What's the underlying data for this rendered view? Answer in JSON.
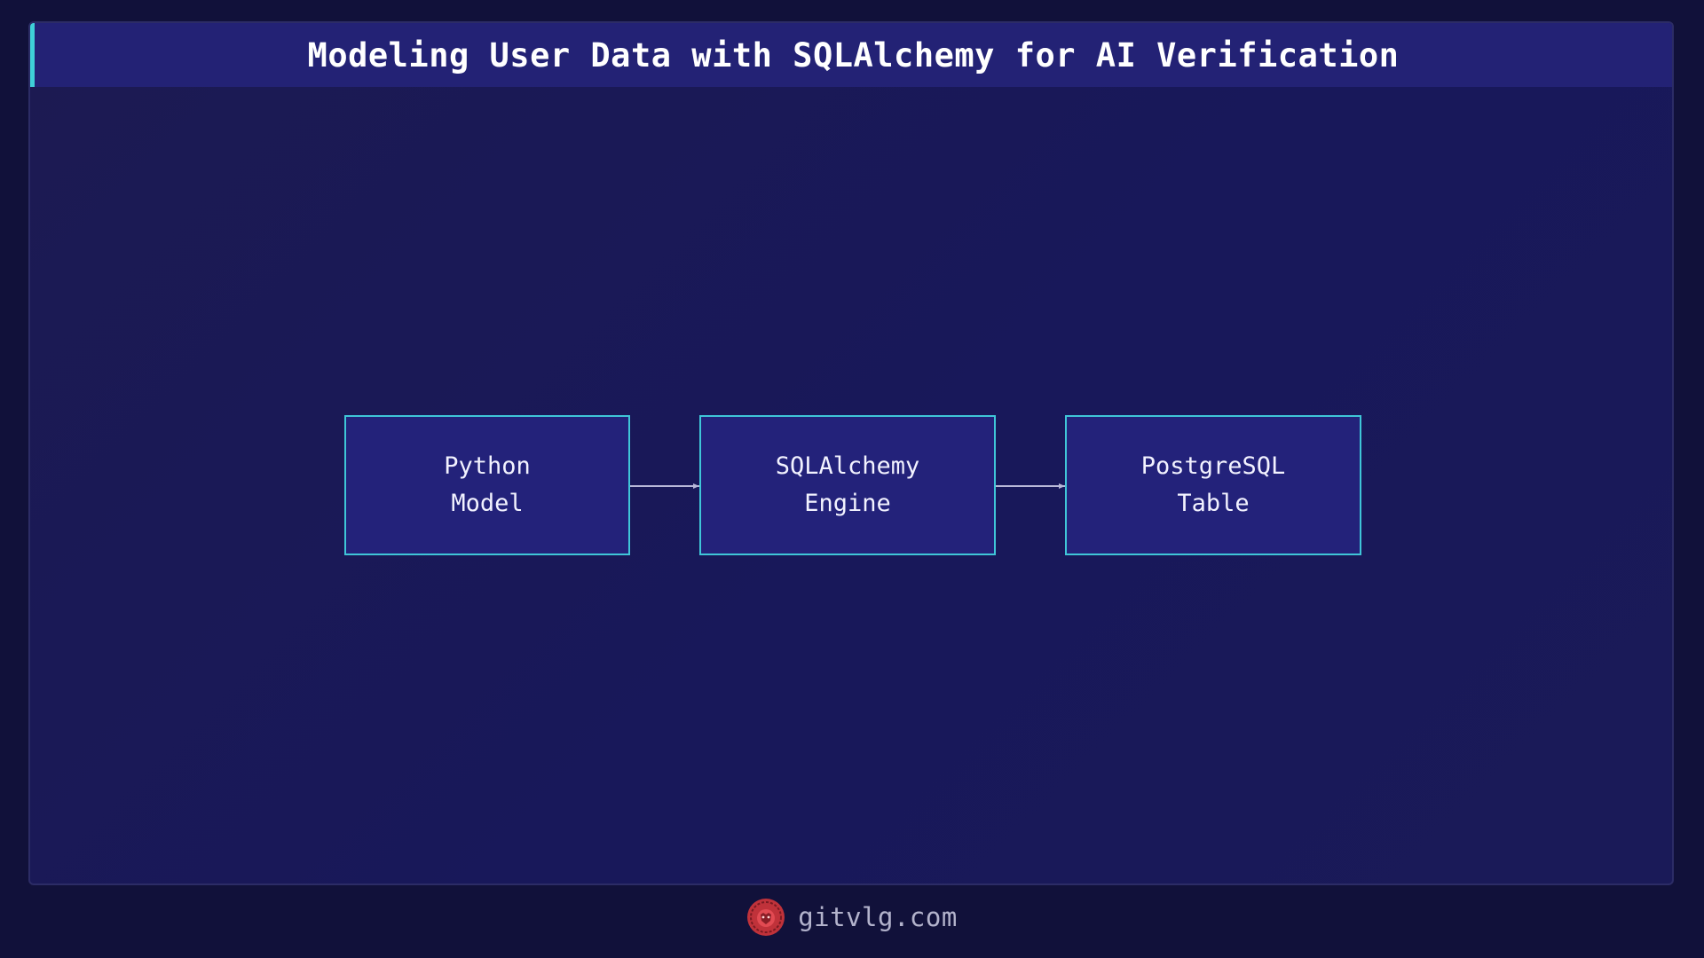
{
  "title": "Modeling User Data with SQLAlchemy for AI Verification",
  "diagram": {
    "nodes": [
      {
        "id": "python-model",
        "label": "Python\nModel"
      },
      {
        "id": "sqlalchemy-engine",
        "label": "SQLAlchemy\nEngine"
      },
      {
        "id": "postgresql-table",
        "label": "PostgreSQL\nTable"
      }
    ],
    "edges": [
      {
        "from": "python-model",
        "to": "sqlalchemy-engine"
      },
      {
        "from": "sqlalchemy-engine",
        "to": "postgresql-table"
      }
    ]
  },
  "footer": {
    "logo_icon": "lion-head-icon",
    "site": "gitvlg.com"
  },
  "colors": {
    "background": "#11113a",
    "panel": "#1b1a55",
    "title_bar": "#232275",
    "accent": "#3fd0d8",
    "node_fill": "#23227a",
    "node_border": "#3fc6d8",
    "edge": "#b8b8d8",
    "logo": "#c0323a"
  }
}
